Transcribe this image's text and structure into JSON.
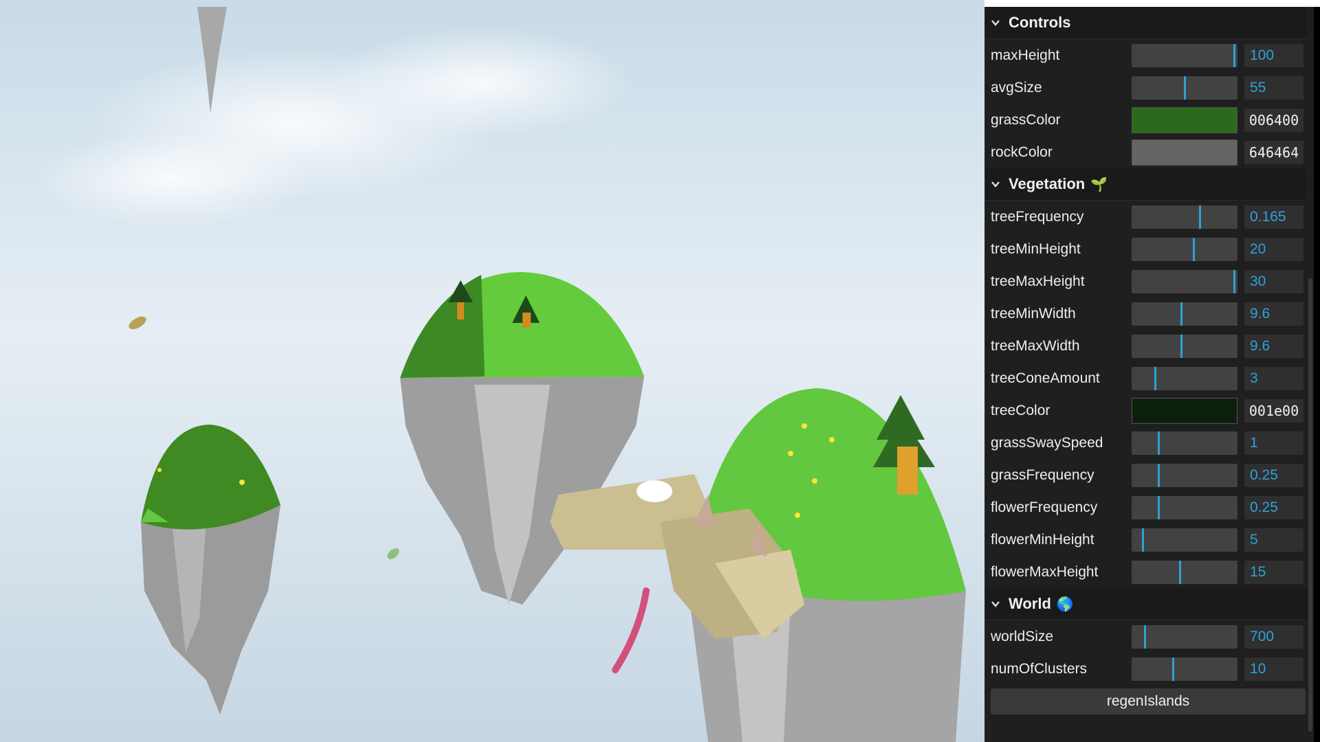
{
  "panel": {
    "title": "Controls",
    "terrain_rows": [
      {
        "label": "maxHeight",
        "value": "100",
        "fraction": 0.98
      },
      {
        "label": "avgSize",
        "value": "55",
        "fraction": 0.5
      }
    ],
    "terrain_colors": [
      {
        "label": "grassColor",
        "hex": "006400",
        "color": "#2b6a1c"
      },
      {
        "label": "rockColor",
        "hex": "646464",
        "color": "#646464"
      }
    ],
    "vegetation": {
      "title": "Vegetation",
      "emoji": "🌱",
      "rows_a": [
        {
          "label": "treeFrequency",
          "value": "0.165",
          "fraction": 0.65
        },
        {
          "label": "treeMinHeight",
          "value": "20",
          "fraction": 0.59
        },
        {
          "label": "treeMaxHeight",
          "value": "30",
          "fraction": 0.98
        },
        {
          "label": "treeMinWidth",
          "value": "9.6",
          "fraction": 0.47
        },
        {
          "label": "treeMaxWidth",
          "value": "9.6",
          "fraction": 0.47
        },
        {
          "label": "treeConeAmount",
          "value": "3",
          "fraction": 0.22
        }
      ],
      "tree_color": {
        "label": "treeColor",
        "hex": "001e00",
        "color": "#0c1f0a"
      },
      "rows_b": [
        {
          "label": "grassSwaySpeed",
          "value": "1",
          "fraction": 0.25
        },
        {
          "label": "grassFrequency",
          "value": "0.25",
          "fraction": 0.25
        },
        {
          "label": "flowerFrequency",
          "value": "0.25",
          "fraction": 0.25
        },
        {
          "label": "flowerMinHeight",
          "value": "5",
          "fraction": 0.1
        },
        {
          "label": "flowerMaxHeight",
          "value": "15",
          "fraction": 0.46
        }
      ]
    },
    "world": {
      "title": "World",
      "emoji": "🌎",
      "rows": [
        {
          "label": "worldSize",
          "value": "700",
          "fraction": 0.12
        },
        {
          "label": "numOfClusters",
          "value": "10",
          "fraction": 0.39
        }
      ],
      "button_label": "regenIslands"
    }
  },
  "colors": {
    "accent": "#2fa1d6",
    "sky_top": "#d4e3ee",
    "grass_light": "#5fcc3e",
    "grass_dark": "#3a8a24",
    "rock": "#a9a9a9",
    "dragon": "#cfc294"
  }
}
